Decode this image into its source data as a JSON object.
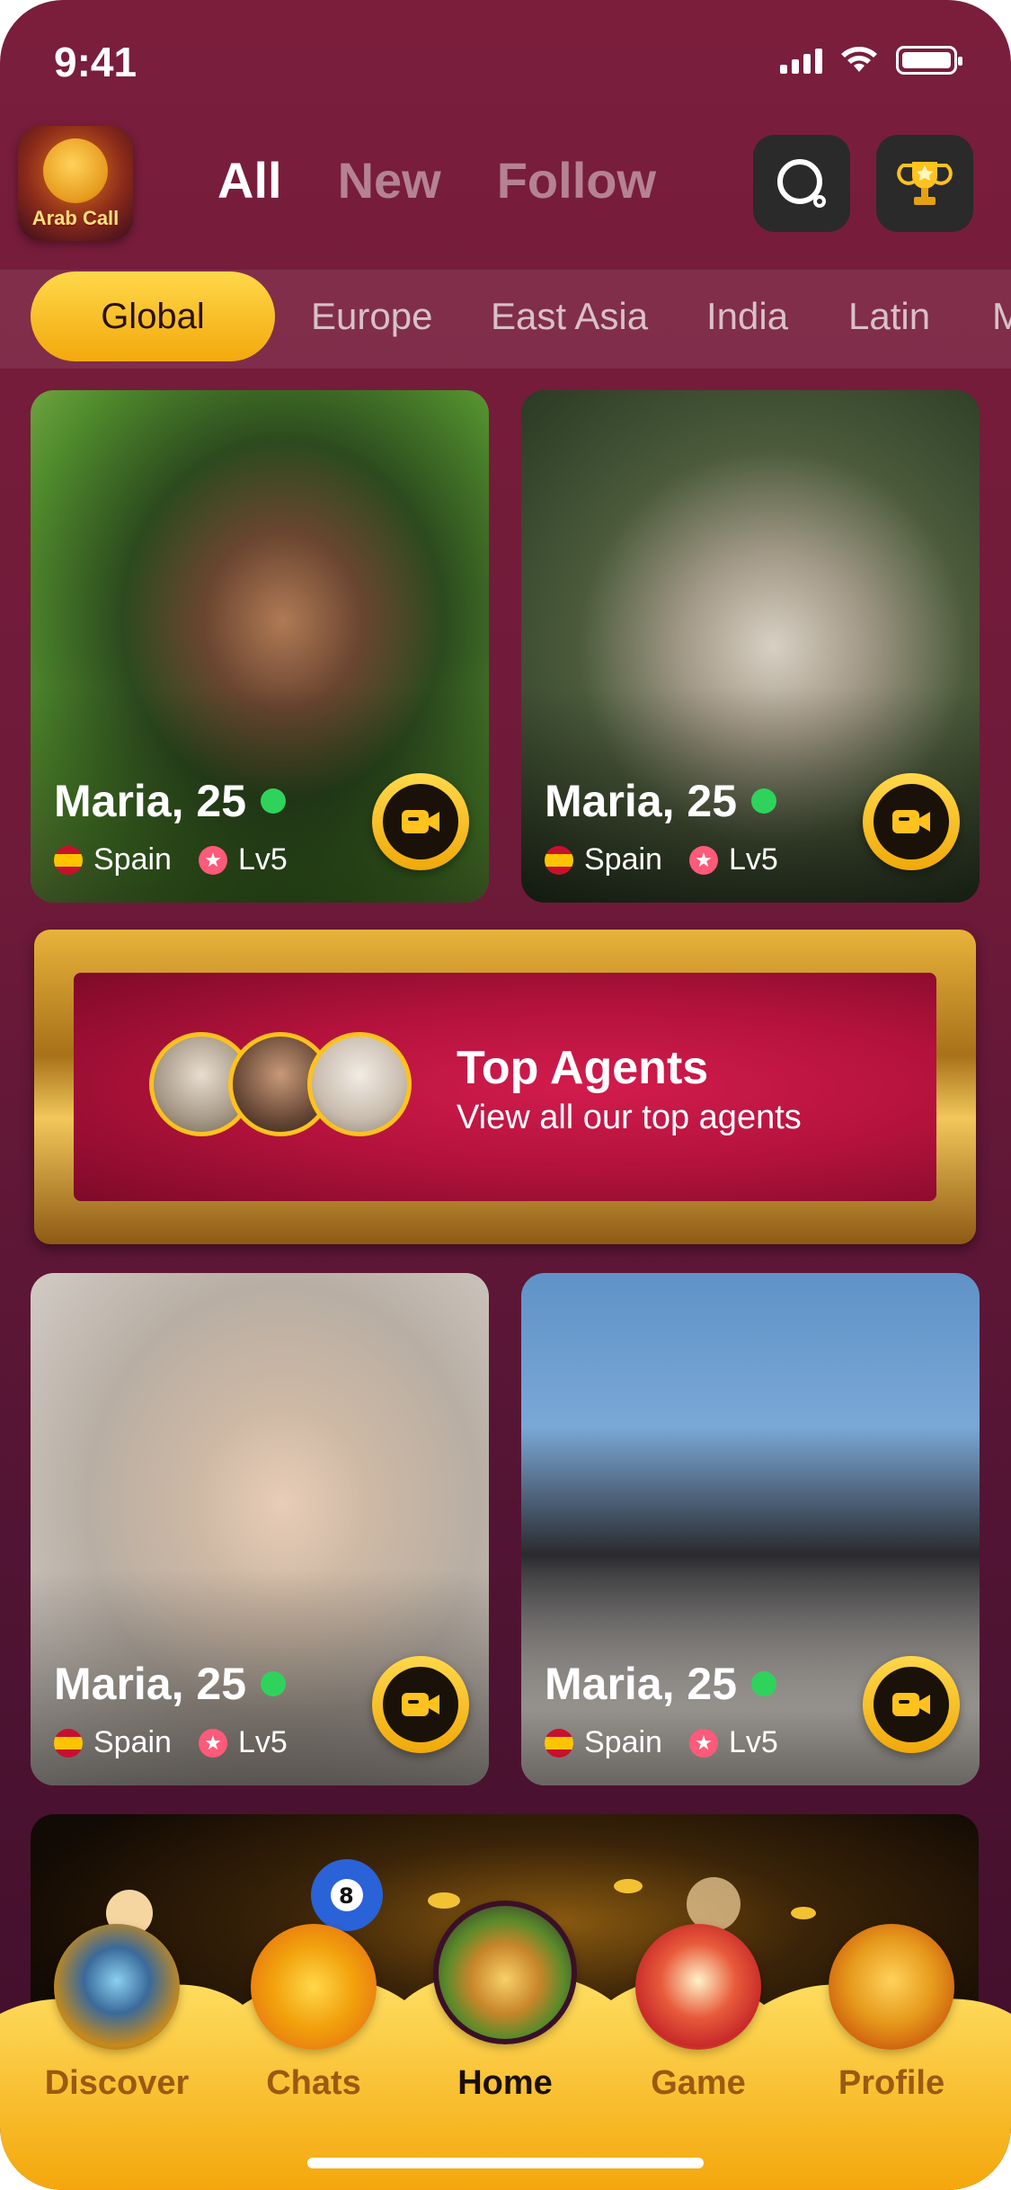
{
  "status_bar": {
    "time": "9:41"
  },
  "header": {
    "logo_text": "Arab Call",
    "tabs": [
      {
        "label": "All"
      },
      {
        "label": "New"
      },
      {
        "label": "Follow"
      }
    ],
    "active_tab": "All",
    "search_icon": "search-icon",
    "trophy_icon": "trophy-icon"
  },
  "regions": {
    "active": "Global",
    "items": [
      "Global",
      "Europe",
      "East Asia",
      "India",
      "Latin",
      "M"
    ]
  },
  "cards": [
    {
      "name": "Maria, 25",
      "country": "Spain",
      "level": "Lv5",
      "online": true
    },
    {
      "name": "Maria, 25",
      "country": "Spain",
      "level": "Lv5",
      "online": true
    },
    {
      "name": "Maria, 25",
      "country": "Spain",
      "level": "Lv5",
      "online": true
    },
    {
      "name": "Maria, 25",
      "country": "Spain",
      "level": "Lv5",
      "online": true
    }
  ],
  "banner": {
    "title": "Top Agents",
    "subtitle": "View all our top agents"
  },
  "bottom_nav": {
    "active": "Home",
    "items": [
      {
        "label": "Discover",
        "icon": "treasure-icon"
      },
      {
        "label": "Chats",
        "icon": "chat-bubble-icon"
      },
      {
        "label": "Home",
        "icon": "house-icon"
      },
      {
        "label": "Game",
        "icon": "slot-machine-icon"
      },
      {
        "label": "Profile",
        "icon": "camel-avatar-icon"
      }
    ]
  },
  "colors": {
    "background": "#7a1e3c",
    "accent_yellow": "#ffd84a",
    "online_green": "#2fd35b",
    "banner_red": "#b3123c",
    "gold": "#e8b33a"
  }
}
